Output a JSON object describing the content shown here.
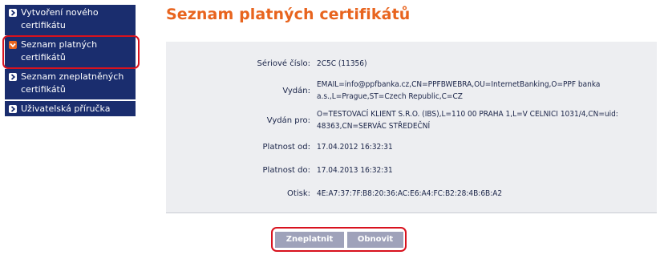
{
  "sidebar": {
    "items": [
      {
        "label": "Vytvoření nového certifikátu"
      },
      {
        "label": "Seznam platných certifikátů"
      },
      {
        "label": "Seznam zneplatněných certifikátů"
      },
      {
        "label": "Uživatelská příručka"
      }
    ]
  },
  "main": {
    "title": "Seznam platných certifikátů",
    "details": [
      {
        "label": "Sériové číslo:",
        "value": "2C5C (11356)"
      },
      {
        "label": "Vydán:",
        "value": "EMAIL=info@ppfbanka.cz,CN=PPFBWEBRA,OU=InternetBanking,O=PPF banka a.s.,L=Prague,ST=Czech Republic,C=CZ"
      },
      {
        "label": "Vydán pro:",
        "value": "O=TESTOVACÍ KLIENT S.R.O. (IBS),L=110 00 PRAHA 1,L=V CELNICI 1031/4,CN=uid: 48363,CN=SERVÁC STŘEDEČNÍ"
      },
      {
        "label": "Platnost od:",
        "value": "17.04.2012 16:32:31"
      },
      {
        "label": "Platnost do:",
        "value": "17.04.2013 16:32:31"
      },
      {
        "label": "Otisk:",
        "value": "4E:A7:37:7F:B8:20:36:AC:E6:A4:FC:B2:28:4B:6B:A2"
      }
    ]
  },
  "buttons": {
    "invalidate_label": "Zneplatnit",
    "refresh_label": "Obnovit"
  },
  "colors": {
    "nav_bg": "#1a2d6e",
    "accent_orange": "#e8641e",
    "highlight_red": "#d8121e",
    "panel_bg": "#edeef1",
    "button_bg": "#9fa2ba"
  }
}
